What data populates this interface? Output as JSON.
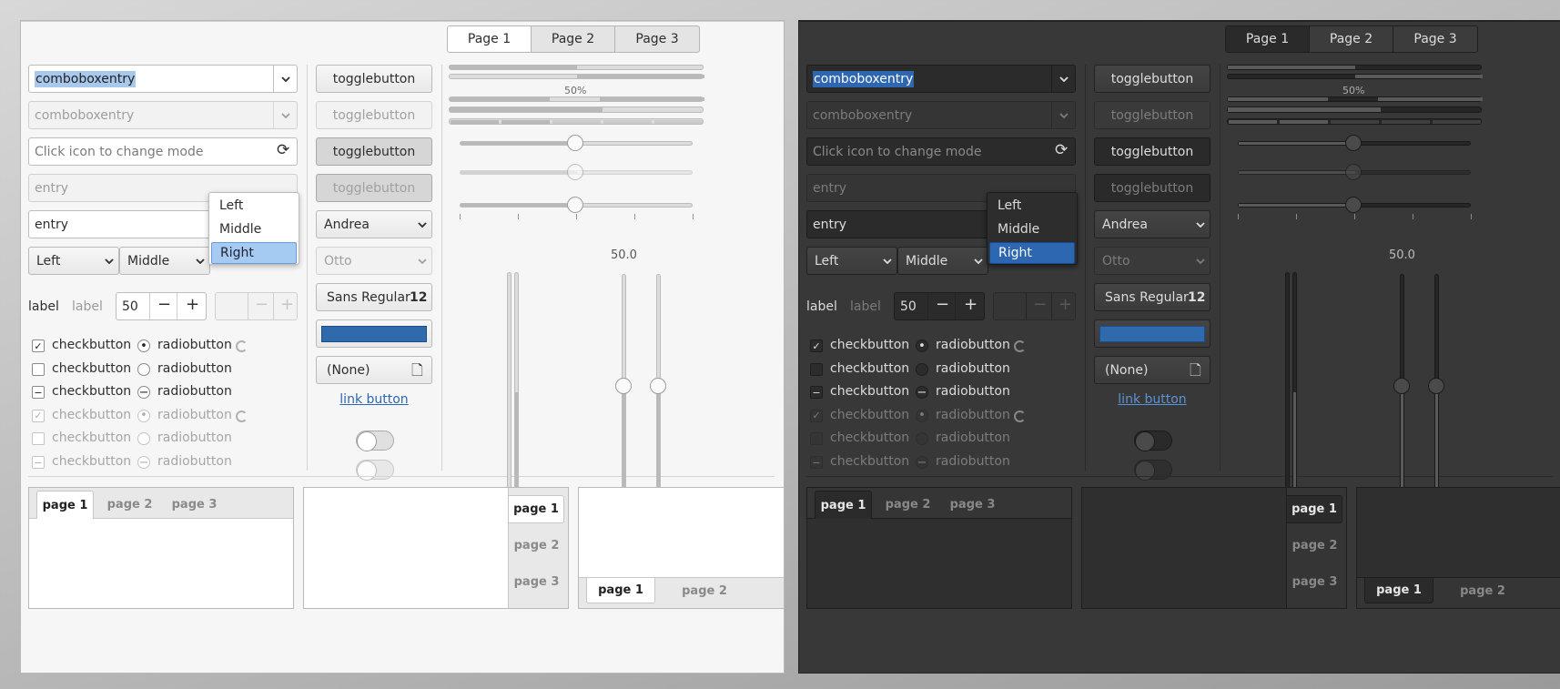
{
  "stack_tabs": [
    "Page 1",
    "Page 2",
    "Page 3"
  ],
  "combo_entry": "comboboxentry",
  "combo_entry_disabled": "comboboxentry",
  "icon_entry_placeholder": "Click icon to change mode",
  "entry_disabled": "entry",
  "entry_value": "entry",
  "combo_left": "Left",
  "combo_middle": "Middle",
  "popup_items": [
    "Left",
    "Middle",
    "Right"
  ],
  "label": "label",
  "label_disabled": "label",
  "spin_value": "50",
  "check_label": "checkbutton",
  "radio_label": "radiobutton",
  "togglebutton": "togglebutton",
  "combo_andrea": "Andrea",
  "combo_otto": "Otto",
  "font_name": "Sans Regular",
  "font_size": "12",
  "file_none": "(None)",
  "link_button": "link button",
  "progress_text": "50%",
  "scale_value": "50.0",
  "nb_tabs": [
    "page 1",
    "page 2",
    "page 3"
  ],
  "colors": {
    "selection_light": "#a8c8ec",
    "selection_dark": "#2e66b2",
    "color_button": "#2f6aad",
    "link_light": "#2a68b4",
    "link_dark": "#5b93d6"
  },
  "icons": {
    "combo_arrow": "chevron-down-icon",
    "refresh": "refresh-icon",
    "minus": "minus-icon",
    "plus": "plus-icon",
    "file": "document-icon",
    "check": "check-icon"
  }
}
